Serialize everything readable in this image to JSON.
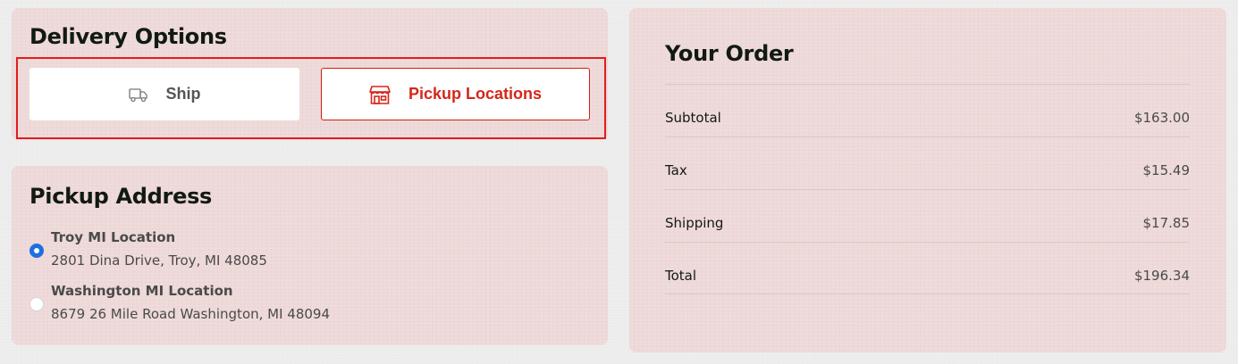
{
  "delivery": {
    "title": "Delivery Options",
    "options": [
      {
        "label": "Ship",
        "icon": "truck-icon",
        "selected": false
      },
      {
        "label": "Pickup Locations",
        "icon": "store-icon",
        "selected": true
      }
    ]
  },
  "pickup": {
    "title": "Pickup Address",
    "locations": [
      {
        "name": "Troy MI Location",
        "address": "2801 Dina Drive, Troy, MI 48085",
        "selected": true
      },
      {
        "name": "Washington MI Location",
        "address": "8679 26 Mile Road Washington, MI 48094",
        "selected": false
      }
    ]
  },
  "order": {
    "title": "Your Order",
    "rows": [
      {
        "label": "Subtotal",
        "value": "$163.00"
      },
      {
        "label": "Tax",
        "value": "$15.49"
      },
      {
        "label": "Shipping",
        "value": "$17.85"
      },
      {
        "label": "Total",
        "value": "$196.34"
      }
    ]
  },
  "colors": {
    "accent": "#d5261a",
    "highlight_border": "#e11d1d",
    "radio_selected": "#1f6fe0",
    "panel": "#eed9d9"
  }
}
